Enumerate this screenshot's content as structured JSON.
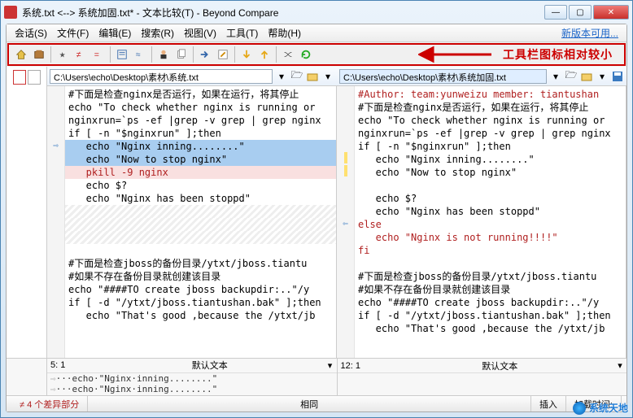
{
  "window": {
    "title": "系统.txt <--> 系统加固.txt* - 文本比较(T) - Beyond Compare",
    "min": "—",
    "max": "▢",
    "close": "✕"
  },
  "menu": {
    "session": "会话(S)",
    "file": "文件(F)",
    "edit": "编辑(E)",
    "search": "搜索(R)",
    "view": "视图(V)",
    "tools": "工具(T)",
    "help": "帮助(H)",
    "new_version": "新版本可用..."
  },
  "annotation": "工具栏图标相对较小",
  "paths": {
    "left": "C:\\Users\\echo\\Desktop\\素材\\系统.txt",
    "right": "C:\\Users\\echo\\Desktop\\素材\\系统加固.txt"
  },
  "left_lines": [
    {
      "t": "#下面是检查nginx是否运行，如果在运行，将其停止",
      "c": ""
    },
    {
      "t": "echo \"To check whether nginx is running or",
      "c": ""
    },
    {
      "t": "nginxrun=`ps -ef |grep -v grep | grep nginx",
      "c": ""
    },
    {
      "t": "if [ -n \"$nginxrun\" ];then",
      "c": ""
    },
    {
      "t": "   echo \"Nginx inning........\"",
      "c": "sel"
    },
    {
      "t": "   echo \"Now to stop nginx\"",
      "c": "sel"
    },
    {
      "t": "   pkill -9 nginx",
      "c": "redbg"
    },
    {
      "t": "   echo $?",
      "c": ""
    },
    {
      "t": "   echo \"Nginx has been stoppd\"",
      "c": ""
    },
    {
      "t": "",
      "c": "hatch"
    },
    {
      "t": "",
      "c": "hatch"
    },
    {
      "t": "",
      "c": "hatch"
    },
    {
      "t": "",
      "c": ""
    },
    {
      "t": "#下面是检查jboss的备份目录/ytxt/jboss.tiantu",
      "c": ""
    },
    {
      "t": "#如果不存在备份目录就创建该目录",
      "c": ""
    },
    {
      "t": "echo \"####TO create jboss backupdir:..\"/y",
      "c": ""
    },
    {
      "t": "if [ -d \"/ytxt/jboss.tiantushan.bak\" ];then",
      "c": ""
    },
    {
      "t": "   echo \"That's good ,because the /ytxt/jb",
      "c": ""
    }
  ],
  "right_lines": [
    {
      "t": "#Author: team:yunweizu member: tiantushan",
      "c": "red"
    },
    {
      "t": "#下面是检查nginx是否运行，如果在运行，将其停止",
      "c": ""
    },
    {
      "t": "echo \"To check whether nginx is running or",
      "c": ""
    },
    {
      "t": "nginxrun=`ps -ef |grep -v grep | grep nginx",
      "c": ""
    },
    {
      "t": "if [ -n \"$nginxrun\" ];then",
      "c": ""
    },
    {
      "t": "   echo \"Nginx inning........\"",
      "c": ""
    },
    {
      "t": "   echo \"Now to stop nginx\"",
      "c": ""
    },
    {
      "t": "",
      "c": ""
    },
    {
      "t": "   echo $?",
      "c": ""
    },
    {
      "t": "   echo \"Nginx has been stoppd\"",
      "c": ""
    },
    {
      "t": "else",
      "c": "red"
    },
    {
      "t": "   echo \"Nginx is not running!!!!\"",
      "c": "red"
    },
    {
      "t": "fi",
      "c": "red"
    },
    {
      "t": "",
      "c": ""
    },
    {
      "t": "#下面是检查jboss的备份目录/ytxt/jboss.tiantu",
      "c": ""
    },
    {
      "t": "#如果不存在备份目录就创建该目录",
      "c": ""
    },
    {
      "t": "echo \"####TO create jboss backupdir:..\"/y",
      "c": ""
    },
    {
      "t": "if [ -d \"/ytxt/jboss.tiantushan.bak\" ];then",
      "c": ""
    },
    {
      "t": "   echo \"That's good ,because the /ytxt/jb",
      "c": ""
    }
  ],
  "bottom": {
    "left_pos": "5: 1",
    "right_pos": "12: 1",
    "default_text": "默认文本",
    "d1": "···echo·\"Nginx·inning........\"",
    "d2": "···echo·\"Nginx·inning........\""
  },
  "status": {
    "diff": "≠ 4 个差异部分",
    "same": "相同",
    "insert": "插入",
    "load": "加载时间:"
  },
  "watermark": "系统天地"
}
